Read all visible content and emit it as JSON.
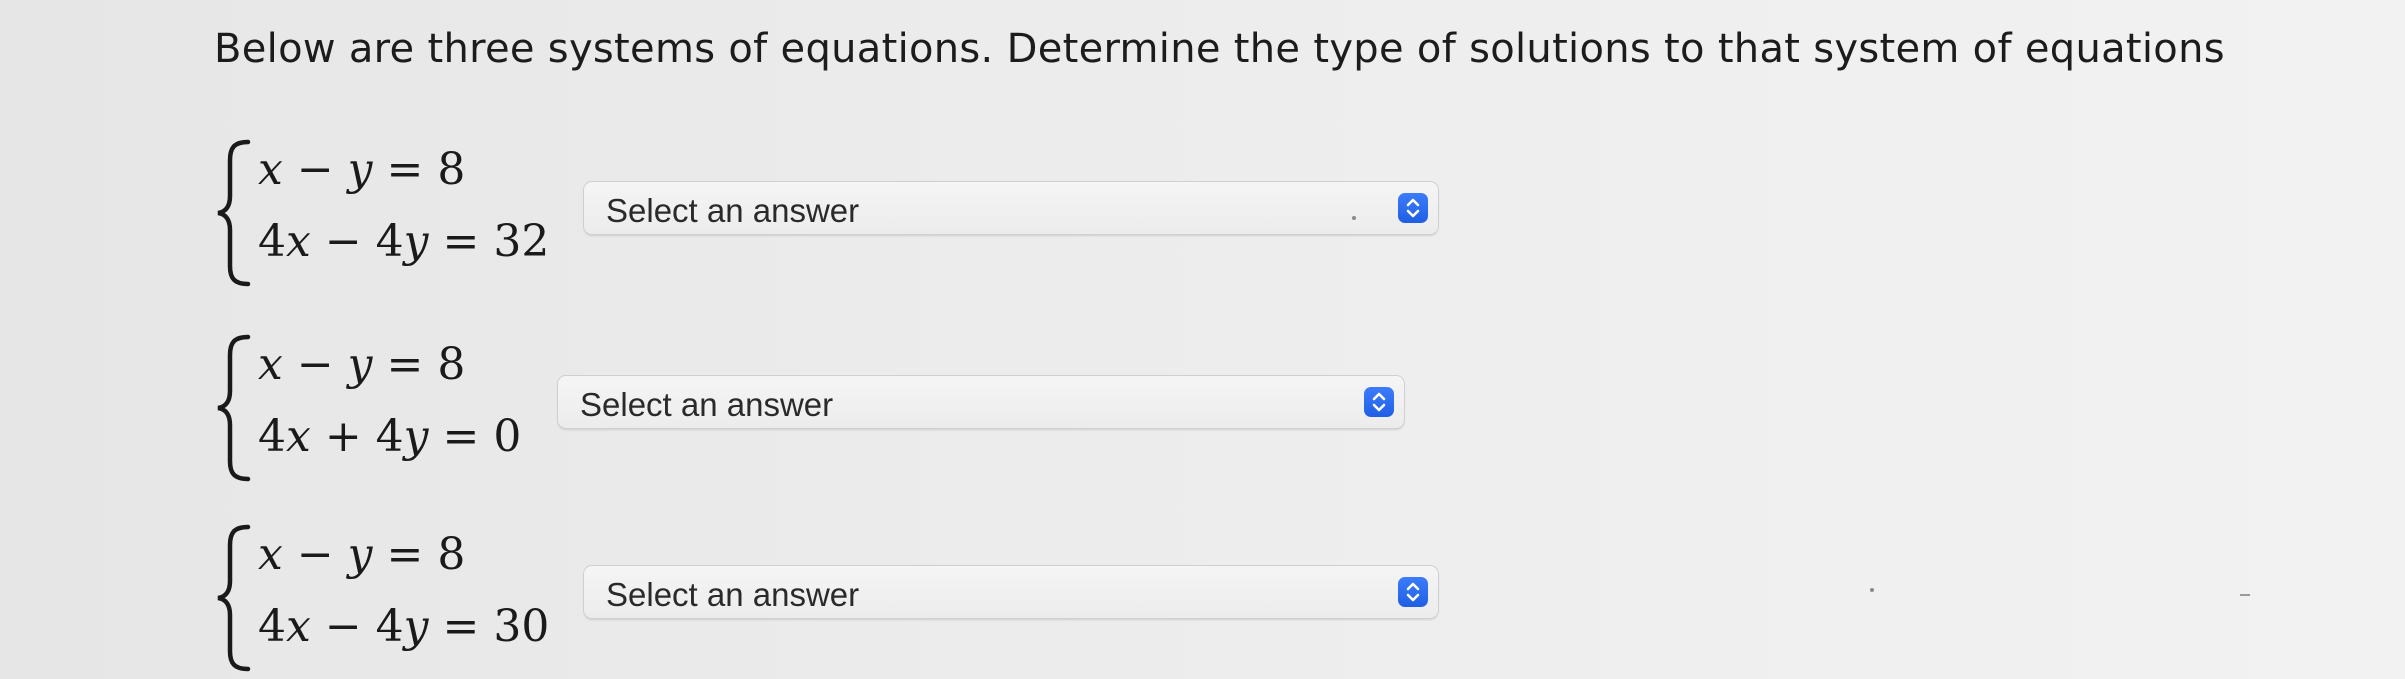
{
  "instruction": "Below are three systems of equations. Determine the type of solutions to that system of equations",
  "systems": [
    {
      "eq1": [
        "x",
        " − ",
        "y",
        " = 8"
      ],
      "eq2": [
        "4",
        "x",
        " − 4",
        "y",
        " = 32"
      ],
      "dropdown_label": "Select an answer"
    },
    {
      "eq1": [
        "x",
        " − ",
        "y",
        " = 8"
      ],
      "eq2": [
        "4",
        "x",
        " + 4",
        "y",
        " = 0"
      ],
      "dropdown_label": "Select an answer"
    },
    {
      "eq1": [
        "x",
        " − ",
        "y",
        " = 8"
      ],
      "eq2": [
        "4",
        "x",
        " − 4",
        "y",
        " = 30"
      ],
      "dropdown_label": "Select an answer"
    }
  ],
  "icons": {
    "dropdown_stepper": "up-down-chevron-icon"
  },
  "colors": {
    "stepper_accent": "#2a6af5",
    "background": "#ececec"
  }
}
